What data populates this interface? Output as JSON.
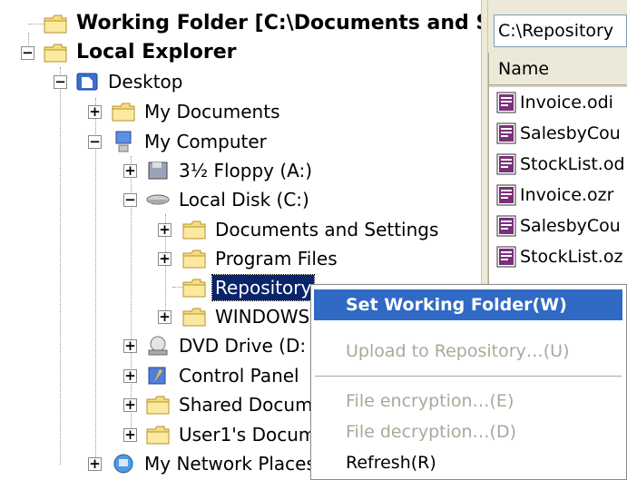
{
  "tree": {
    "working_folder": "Working Folder [C:\\Documents and Se",
    "local_explorer": "Local Explorer",
    "desktop": "Desktop",
    "my_documents": "My Documents",
    "my_computer": "My Computer",
    "floppy": "3½ Floppy (A:)",
    "local_disk": "Local Disk (C:)",
    "docs_settings": "Documents and Settings",
    "program_files": "Program Files",
    "repository": "Repository",
    "windows": "WINDOWS",
    "dvd": "DVD Drive (D:",
    "control_panel": "Control Panel",
    "shared_docs": "Shared Docum",
    "user1_docs": "User1's Docum",
    "network": "My Network Places"
  },
  "right": {
    "path": "C:\\Repository",
    "column_name": "Name",
    "files": [
      "Invoice.odi",
      "SalesbyCou",
      "StockList.od",
      "Invoice.ozr",
      "SalesbyCou",
      "StockList.oz"
    ]
  },
  "menu": {
    "set_working": "Set Working Folder(W)",
    "upload": "Upload to Repository…(U)",
    "encrypt": "File encryption…(E)",
    "decrypt": "File decryption…(D)",
    "refresh": "Refresh(R)"
  },
  "colors": {
    "selection": "#0a246a",
    "menu_highlight": "#316ac5",
    "disabled": "#aca899",
    "folder": "#f3d36c"
  }
}
